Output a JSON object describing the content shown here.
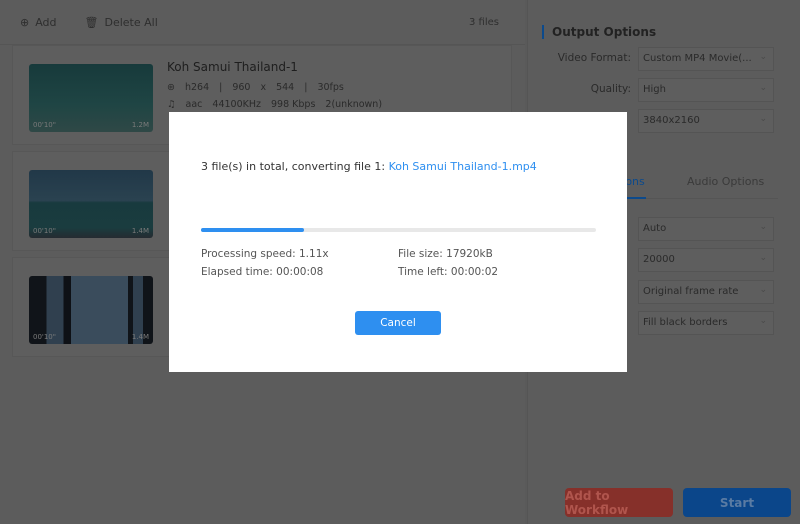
{
  "toolbar": {
    "add_label": "Add",
    "delete_all_label": "Delete All",
    "files_count": "3 files"
  },
  "files": [
    {
      "name": "Koh Samui Thailand-1",
      "codec": "h264",
      "width": "960",
      "x": "x",
      "height": "544",
      "fps": "30fps",
      "audio_codec": "aac",
      "sample_rate": "44100KHz",
      "bitrate": "998 Kbps",
      "channels": "2(unknown)",
      "duration": "00'10\"",
      "size": "1.2M"
    },
    {
      "duration": "00'10\"",
      "size": "1.4M"
    },
    {
      "duration": "00'10\"",
      "size": "1.4M"
    }
  ],
  "output": {
    "title": "Output Options",
    "video_format_label": "Video Format:",
    "video_format": "Custom MP4 Movie(...",
    "quality_label": "Quality:",
    "quality": "High",
    "resolution": "3840x2160",
    "tabs": [
      "Video Options",
      "Audio Options"
    ],
    "encoder": "Auto",
    "bitrate": "20000",
    "frame_rate": "Original frame rate",
    "zoom": "Fill black borders"
  },
  "footer": {
    "workflow_label": "Add to Workflow",
    "start_label": "Start"
  },
  "dialog": {
    "message": "3 file(s) in total, converting file 1:",
    "current_file": "Koh Samui Thailand-1.mp4",
    "progress_percent": 26,
    "speed": "Processing speed: 1.11x",
    "file_size": "File size: 17920kB",
    "elapsed": "Elapsed time: 00:00:08",
    "time_left": "Time left: 00:00:02",
    "cancel_label": "Cancel"
  },
  "colors": {
    "accent": "#2e8ff0",
    "workflow": "#e0453a",
    "start": "#1a6fe0"
  }
}
